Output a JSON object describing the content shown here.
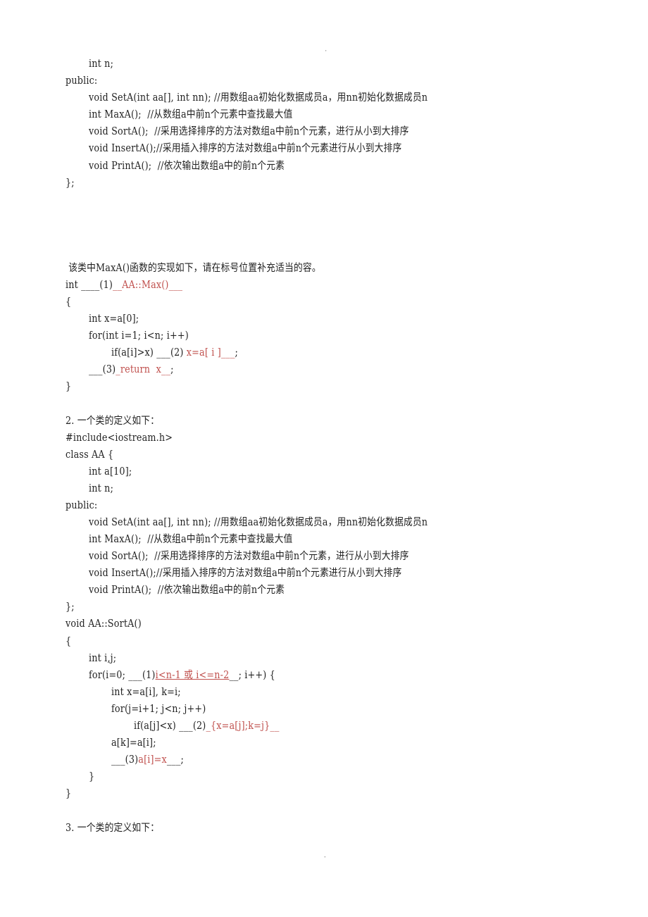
{
  "page_marks": {
    "top": "'",
    "bottom": "-"
  },
  "block1": {
    "lines": [
      "int n;",
      "public:",
      "void SetA(int aa[], int nn); //用数组aa初始化数据成员a，用nn初始化数据成员n",
      "int MaxA();  //从数组a中前n个元素中查找最大值",
      "void SortA();  //采用选择排序的方法对数组a中前n个元素，进行从小到大排序",
      "void InsertA();//采用插入排序的方法对数组a中前n个元素进行从小到大排序",
      "void PrintA();  //依次输出数组a中的前n个元素",
      "};"
    ]
  },
  "maxa": {
    "prompt": " 该类中MaxA()函数的实现如下，请在标号位置补充适当的容。",
    "l1_pre": "int ____(1)",
    "l1_ans": "__AA::Max()___",
    "l2": "{",
    "l3": "int x=a[0];",
    "l4": "for(int i=1; i<n; i++)",
    "l5_pre": "if(a[i]>x) ___(2) ",
    "l5_ans": "x=a[ i ]___",
    "l5_post": ";",
    "l6_pre": "___(3)",
    "l6_ans": "_return  x__",
    "l6_post": ";",
    "l7": "}"
  },
  "q2": {
    "heading": "2. 一个类的定义如下：",
    "lines": [
      "#include<iostream.h>",
      "class AA {",
      "int a[10];",
      "int n;",
      "public:",
      "void SetA(int aa[], int nn); //用数组aa初始化数据成员a，用nn初始化数据成员n",
      "int MaxA();  //从数组a中前n个元素中查找最大值",
      "void SortA();  //采用选择排序的方法对数组a中前n个元素，进行从小到大排序",
      "void InsertA();//采用插入排序的方法对数组a中前n个元素进行从小到大排序",
      "void PrintA();  //依次输出数组a中的前n个元素",
      "};",
      "void AA::SortA()",
      "{",
      "int i,j;"
    ],
    "for_pre": "for(i=0; ___(1)",
    "for_ans": "i<n-1 或 i<=n-2",
    "for_post": "__; i++) {",
    "l_x": "int x=a[i], k=i;",
    "l_forj": "for(j=i+1; j<n; j++)",
    "l_if_pre": "if(a[j]<x) ___(2)",
    "l_if_ans": "_{x=a[j];k=j}__",
    "l_ak": "a[k]=a[i];",
    "l_3_pre": "___(3)",
    "l_3_ans": "a[i]=x",
    "l_3_post": "___;",
    "close_inner": "}",
    "close_outer": "}"
  },
  "q3": {
    "heading": "3. 一个类的定义如下："
  }
}
